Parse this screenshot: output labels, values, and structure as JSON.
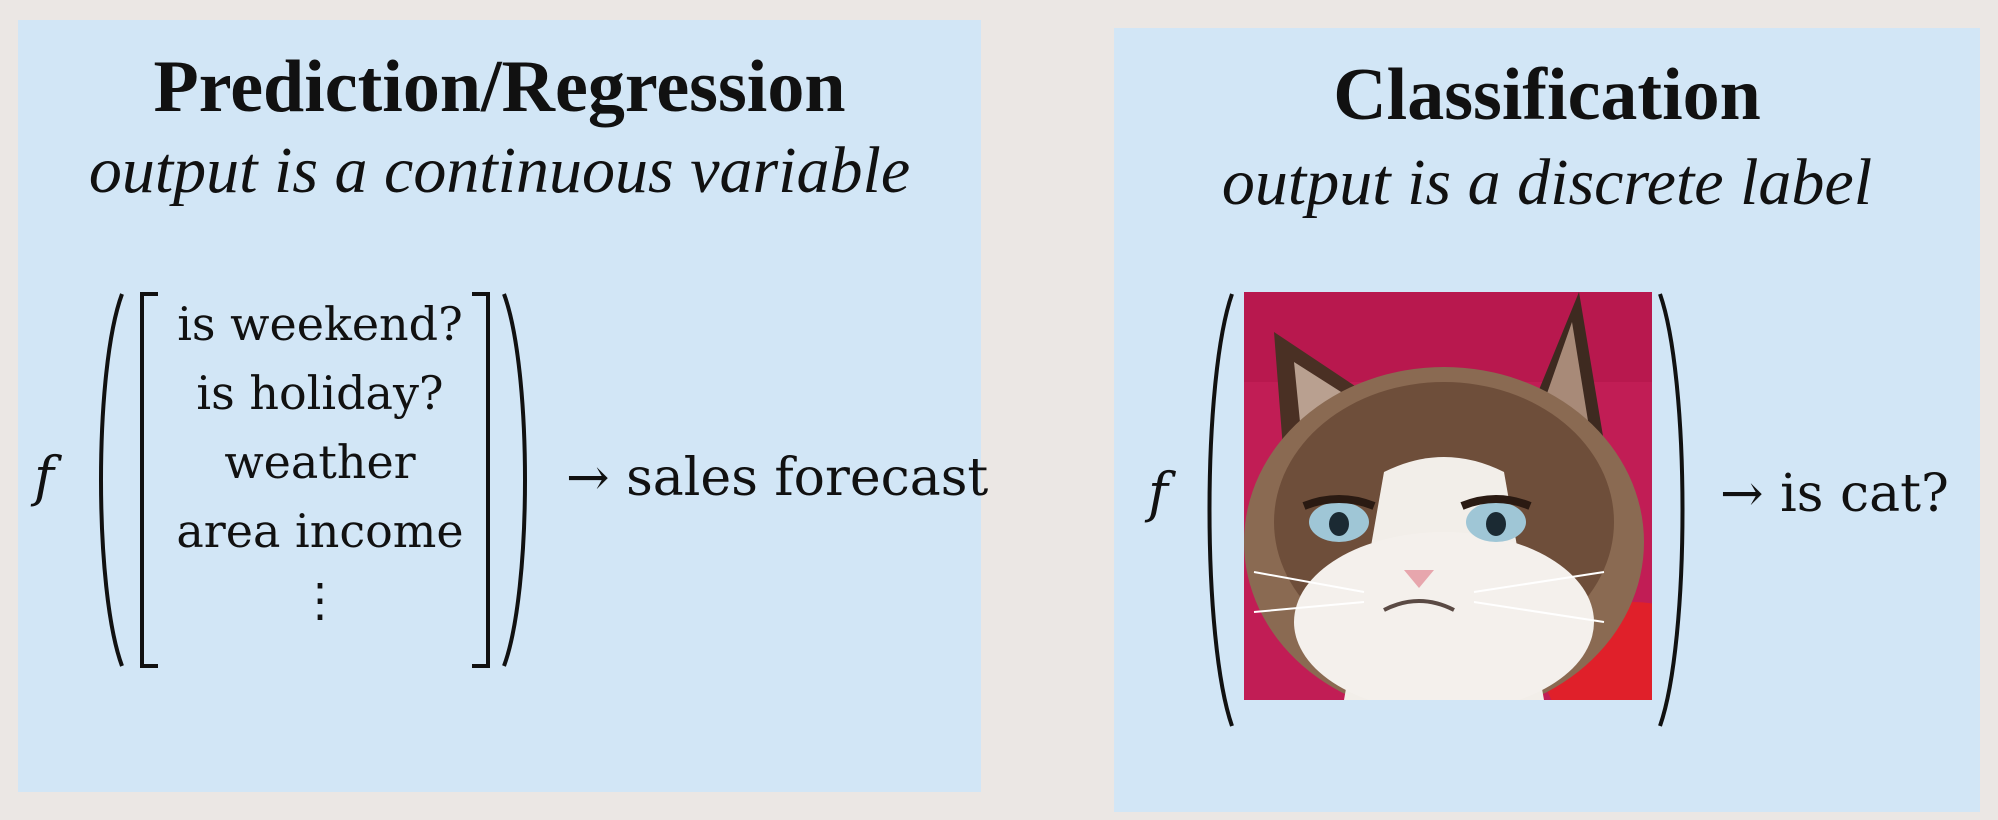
{
  "regression": {
    "title": "Prediction/Regression",
    "subtitle": "output is a continuous variable",
    "function_symbol": "f",
    "inputs": [
      "is weekend?",
      "is holiday?",
      "weather",
      "area income",
      "⋮"
    ],
    "output": "→ sales forecast"
  },
  "classification": {
    "title": "Classification",
    "subtitle": "output is a discrete label",
    "function_symbol": "f",
    "input_image": "grumpy-cat-photo",
    "output": "→ is cat?"
  },
  "colors": {
    "page_background": "#ebe7e4",
    "panel_background": "#d2e6f6",
    "cat_photo_background": "#c11d55"
  }
}
